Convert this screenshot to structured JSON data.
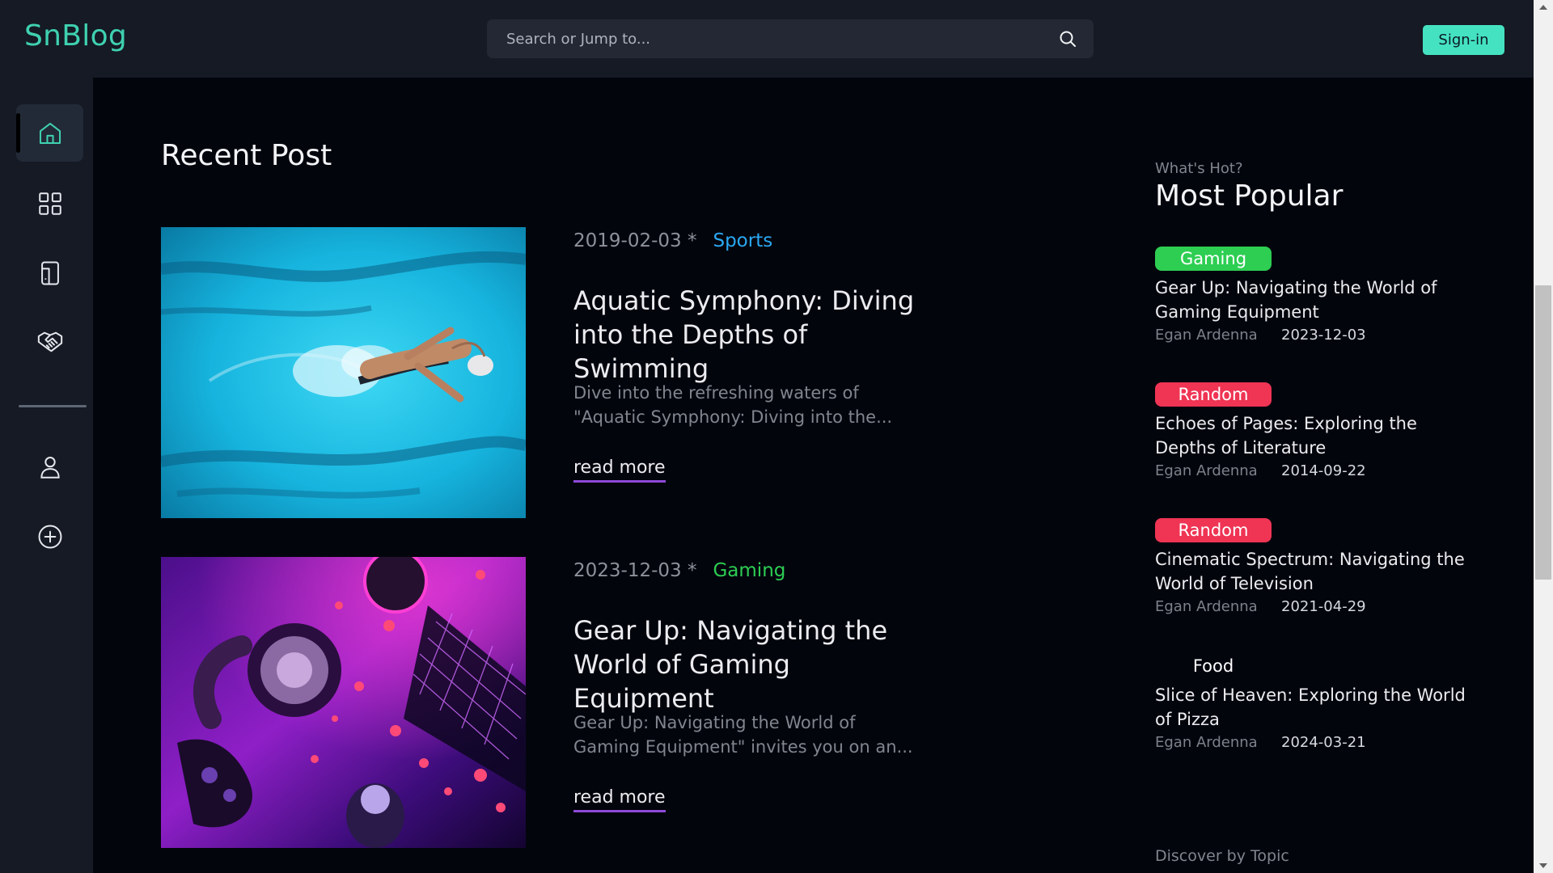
{
  "app": {
    "logo": "SnBlog"
  },
  "search": {
    "placeholder": "Search or Jump to...",
    "icon": "search-icon"
  },
  "header": {
    "signin_label": "Sign-in"
  },
  "sidebar": {
    "items": [
      {
        "name": "home",
        "icon": "home-icon",
        "active": true
      },
      {
        "name": "categories",
        "icon": "grid-icon",
        "active": false
      },
      {
        "name": "mobile",
        "icon": "tablet-icon",
        "active": false
      },
      {
        "name": "partners",
        "icon": "handshake-icon",
        "active": false
      },
      {
        "name": "profile",
        "icon": "user-icon",
        "active": false
      },
      {
        "name": "create",
        "icon": "plus-circle-icon",
        "active": false
      }
    ]
  },
  "main": {
    "section_title": "Recent Post",
    "posts": [
      {
        "date": "2019-02-03 *",
        "category": "Sports",
        "category_color": "#2aa8f2",
        "title": "Aquatic Symphony: Diving into the Depths of Swimming",
        "excerpt": "Dive into the refreshing waters of \"Aquatic Symphony: Diving into the...",
        "read_more": "read more",
        "image": "swimmer-photo"
      },
      {
        "date": "2023-12-03 *",
        "category": "Gaming",
        "category_color": "#2dce52",
        "title": "Gear Up: Navigating the World of Gaming Equipment",
        "excerpt": "Gear Up: Navigating the World of Gaming Equipment\" invites you on an...",
        "read_more": "read more",
        "image": "gaming-gear-photo"
      }
    ]
  },
  "popular": {
    "kicker": "What's Hot?",
    "title": "Most Popular",
    "items": [
      {
        "badge": "Gaming",
        "badge_color": "#2dce52",
        "title": "Gear Up: Navigating the World of Gaming Equipment",
        "author": "Egan Ardenna",
        "date": "2023-12-03"
      },
      {
        "badge": "Random",
        "badge_color": "#ef3454",
        "title": "Echoes of Pages: Exploring the Depths of Literature",
        "author": "Egan Ardenna",
        "date": "2014-09-22"
      },
      {
        "badge": "Random",
        "badge_color": "#ef3454",
        "title": "Cinematic Spectrum: Navigating the World of Television",
        "author": "Egan Ardenna",
        "date": "2021-04-29"
      },
      {
        "badge": "Food",
        "badge_color": "transparent",
        "title": "Slice of Heaven: Exploring the World of Pizza",
        "author": "Egan Ardenna",
        "date": "2024-03-21"
      }
    ],
    "discover_label": "Discover by Topic"
  }
}
